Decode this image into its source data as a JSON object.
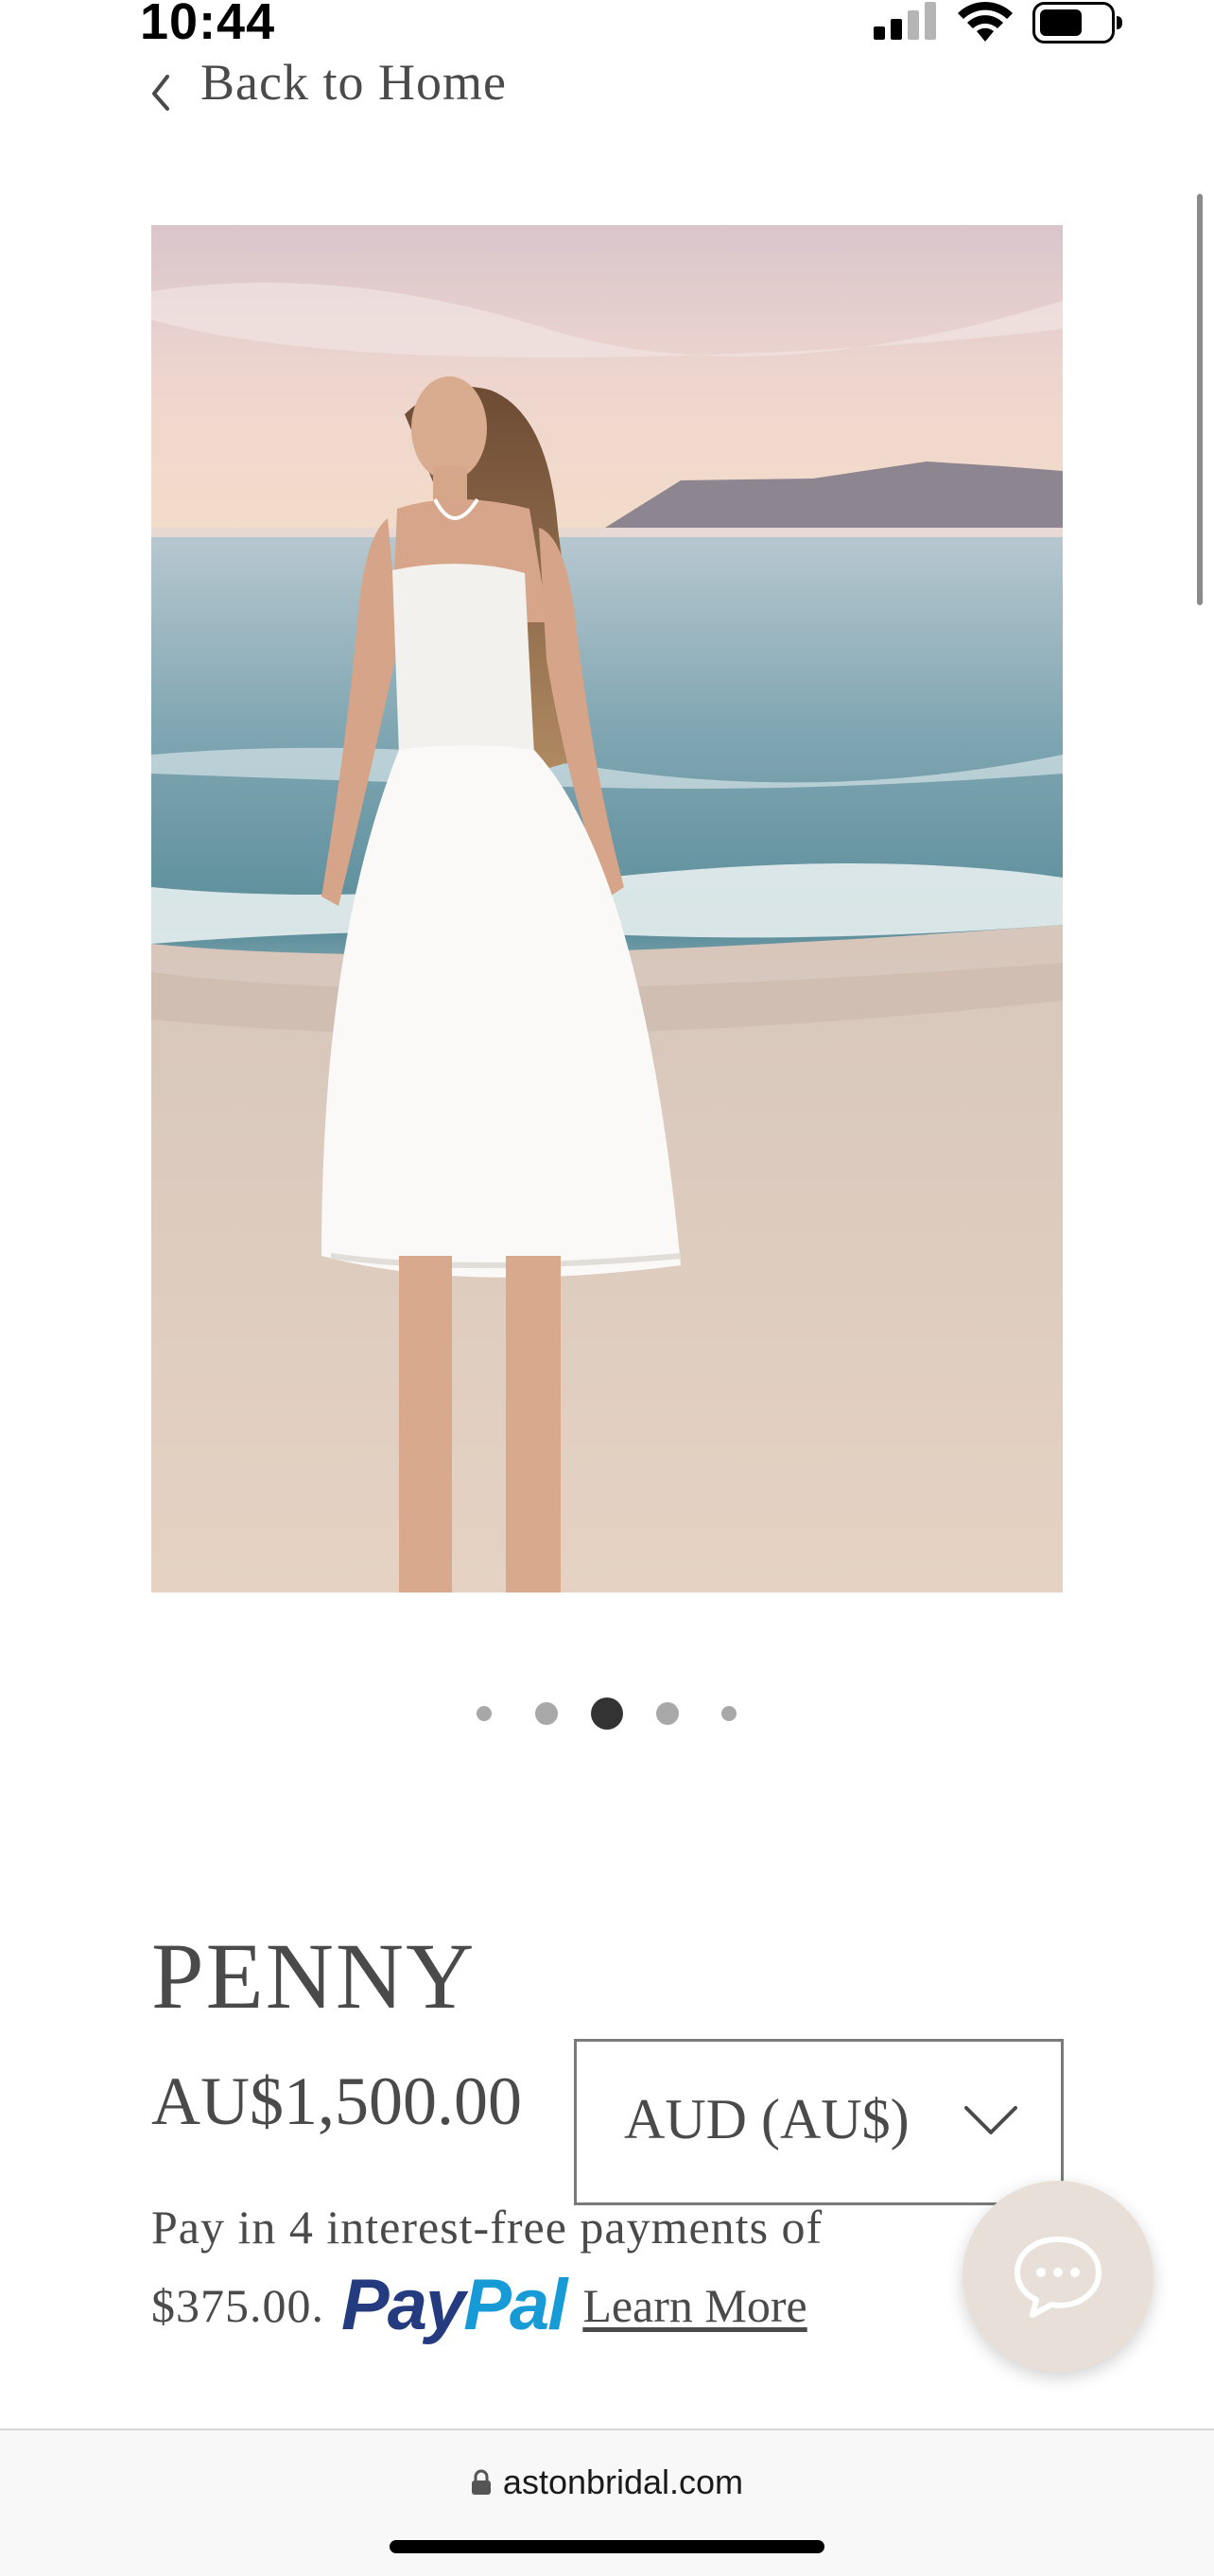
{
  "status_bar": {
    "time": "10:44",
    "icons": [
      "signal-icon",
      "wifi-icon",
      "battery-icon"
    ]
  },
  "nav": {
    "back_label": "Back to Home",
    "back_icon": "chevron-left-icon"
  },
  "product": {
    "image_description_icon": "product-photo",
    "gallery": {
      "count": 5,
      "active_index": 2
    },
    "title": "PENNY",
    "price": "AU$1,500.00",
    "currency": {
      "selected": "AUD (AU$)",
      "icon": "chevron-down-icon"
    },
    "paypal": {
      "line1": "Pay in 4 interest-free payments of",
      "amount": "$375.00.",
      "logo_part1": "Pay",
      "logo_part2": "Pal",
      "learn_more": "Learn More",
      "logo_colors": [
        "#253b80",
        "#179bd7"
      ]
    }
  },
  "chat": {
    "icon": "chat-bubble-icon",
    "color": "#e8e0d8"
  },
  "browser": {
    "url": "astonbridal.com",
    "icon": "lock-icon"
  }
}
